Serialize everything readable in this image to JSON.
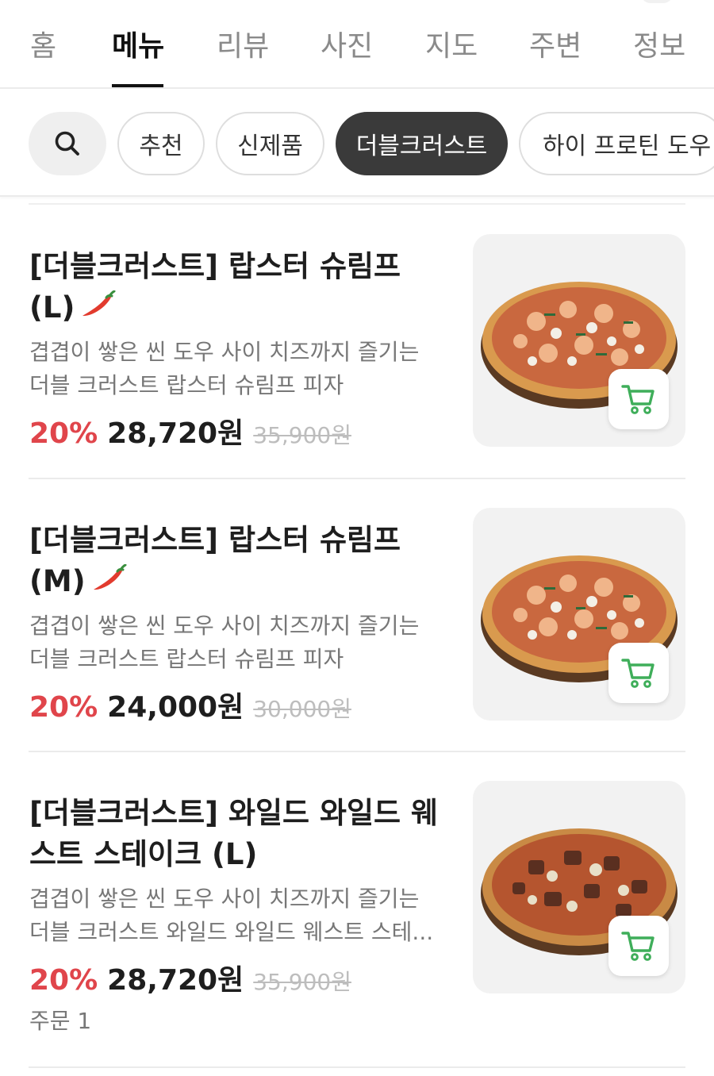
{
  "tabs": [
    {
      "label": "홈",
      "active": false
    },
    {
      "label": "메뉴",
      "active": true
    },
    {
      "label": "리뷰",
      "active": false
    },
    {
      "label": "사진",
      "active": false
    },
    {
      "label": "지도",
      "active": false
    },
    {
      "label": "주변",
      "active": false
    },
    {
      "label": "정보",
      "active": false
    }
  ],
  "filters": {
    "search_icon": "search-icon",
    "chips": [
      {
        "label": "추천",
        "active": false
      },
      {
        "label": "신제품",
        "active": false
      },
      {
        "label": "더블크러스트",
        "active": true
      },
      {
        "label": "하이 프로틴 도우",
        "active": false
      }
    ]
  },
  "menu": [
    {
      "title_line1": "[더블크러스트] 랍스터 슈림프",
      "title_line2": "(L)",
      "spicy": true,
      "desc_line1": "겹겹이 쌓은 씬 도우 사이 치즈까지 즐기는",
      "desc_line2": "더블 크러스트 랍스터 슈림프 피자",
      "discount": "20%",
      "price": "28,720원",
      "original_price": "35,900원",
      "orders": ""
    },
    {
      "title_line1": "[더블크러스트] 랍스터 슈림프",
      "title_line2": "(M)",
      "spicy": true,
      "desc_line1": "겹겹이 쌓은 씬 도우 사이 치즈까지 즐기는",
      "desc_line2": "더블 크러스트 랍스터 슈림프 피자",
      "discount": "20%",
      "price": "24,000원",
      "original_price": "30,000원",
      "orders": ""
    },
    {
      "title_line1": "[더블크러스트] 와일드 와일드 웨",
      "title_line2": "스트 스테이크 (L)",
      "spicy": false,
      "desc_line1": "겹겹이 쌓은 씬 도우 사이 치즈까지 즐기는",
      "desc_line2": "더블 크러스트 와일드 와일드 웨스트 스테...",
      "discount": "20%",
      "price": "28,720원",
      "original_price": "35,900원",
      "orders": "주문 1"
    }
  ],
  "colors": {
    "accent_discount": "#e0454b",
    "active_chip": "#3a3a3a",
    "cart_icon": "#3fae5a",
    "chili": "#e23b2e"
  }
}
